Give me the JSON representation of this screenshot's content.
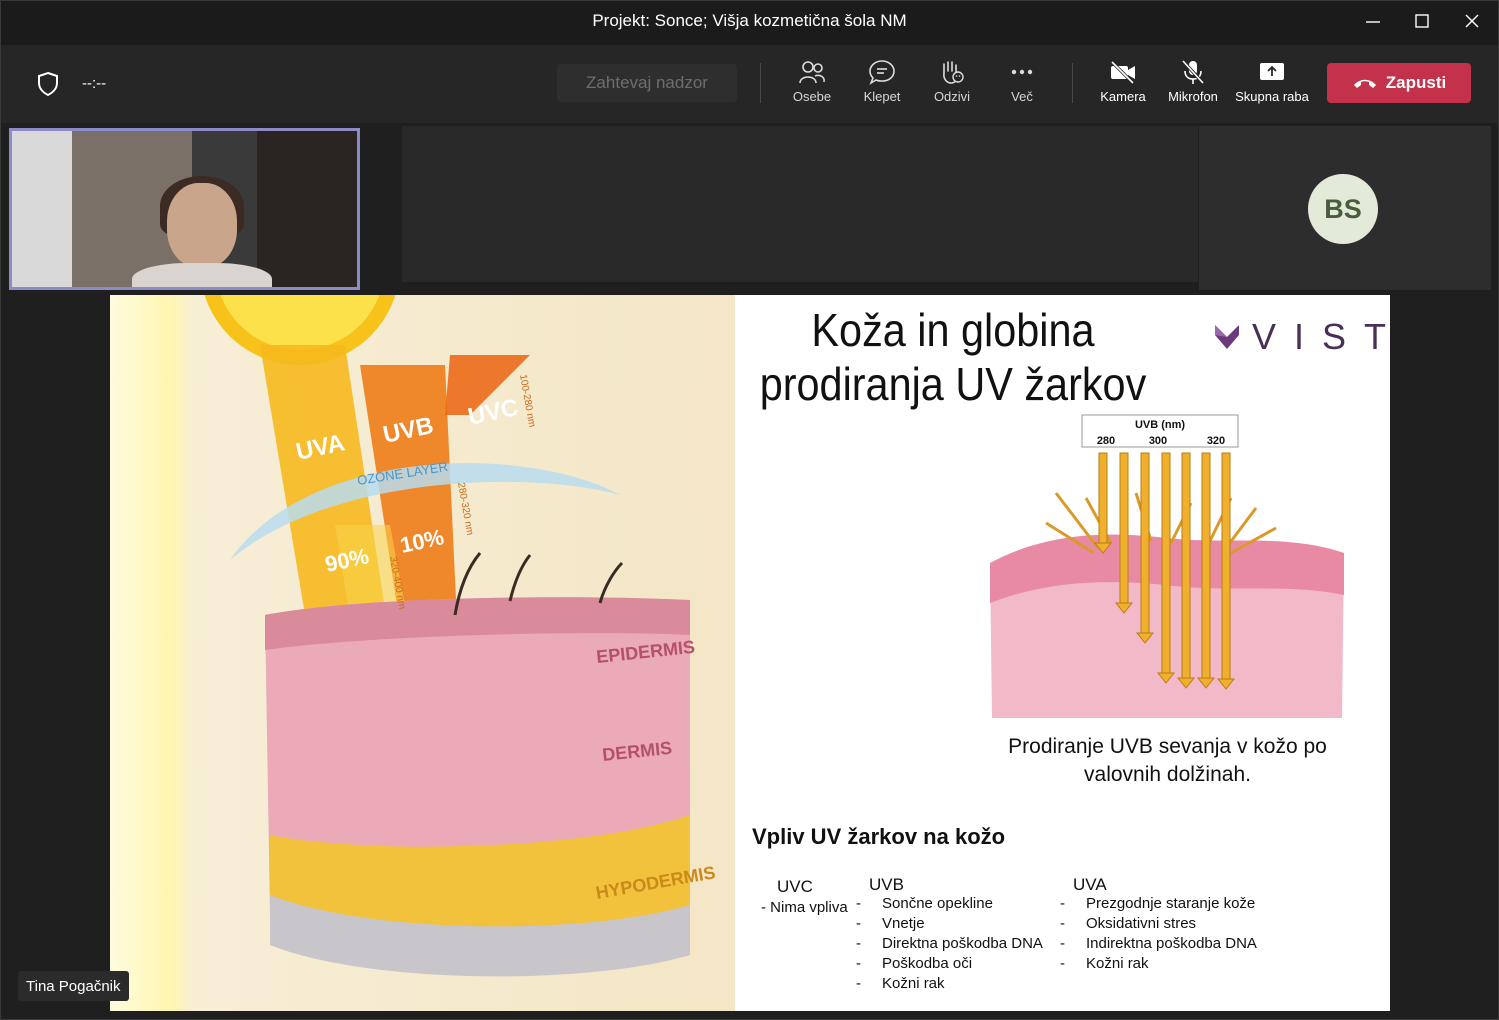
{
  "window": {
    "title": "Projekt: Sonce; Višja kozmetična šola NM"
  },
  "toolbar": {
    "timer": "--:--",
    "request_control": "Zahtevaj nadzor",
    "people": "Osebe",
    "chat": "Klepet",
    "reactions": "Odzivi",
    "more": "Več",
    "camera": "Kamera",
    "mic": "Mikrofon",
    "share": "Skupna raba",
    "leave": "Zapusti",
    "leave_color": "#c4314b"
  },
  "participants": {
    "avatar_initials": "BS",
    "presenter_name": "Tina Pogačnik"
  },
  "slide": {
    "title_line1": "Koža in globina",
    "title_line2": "prodiranja UV žarkov",
    "logo_text": "VIST",
    "illustration": {
      "uva": "UVA",
      "uvb": "UVB",
      "uvc": "UVC",
      "ozone": "OZONE LAYER",
      "pct_uva": "90%",
      "pct_uvb": "10%",
      "nm_uvc": "100-280 nm",
      "nm_uvb": "280-320 nm",
      "nm_uva": "320-400 nm",
      "epidermis": "EPIDERMIS",
      "dermis": "DERMIS",
      "hypodermis": "HYPODERMIS"
    },
    "uvb_figure": {
      "header": "UVB (nm)",
      "t280": "280",
      "t300": "300",
      "t320": "320"
    },
    "caption_line1": "Prodiranje UVB sevanja v kožo po",
    "caption_line2": "valovnih dolžinah.",
    "section_title": "Vpliv UV žarkov na kožo",
    "uvc": {
      "heading": "UVC",
      "item": "- Nima vpliva"
    },
    "uvb": {
      "heading": "UVB",
      "items": [
        "Sončne opekline",
        "Vnetje",
        "Direktna poškodba DNA",
        "Poškodba oči",
        "Kožni rak"
      ]
    },
    "uva": {
      "heading": "UVA",
      "items": [
        "Prezgodnje staranje kože",
        "Oksidativni stres",
        "Indirektna poškodba DNA",
        "Kožni rak"
      ]
    }
  }
}
